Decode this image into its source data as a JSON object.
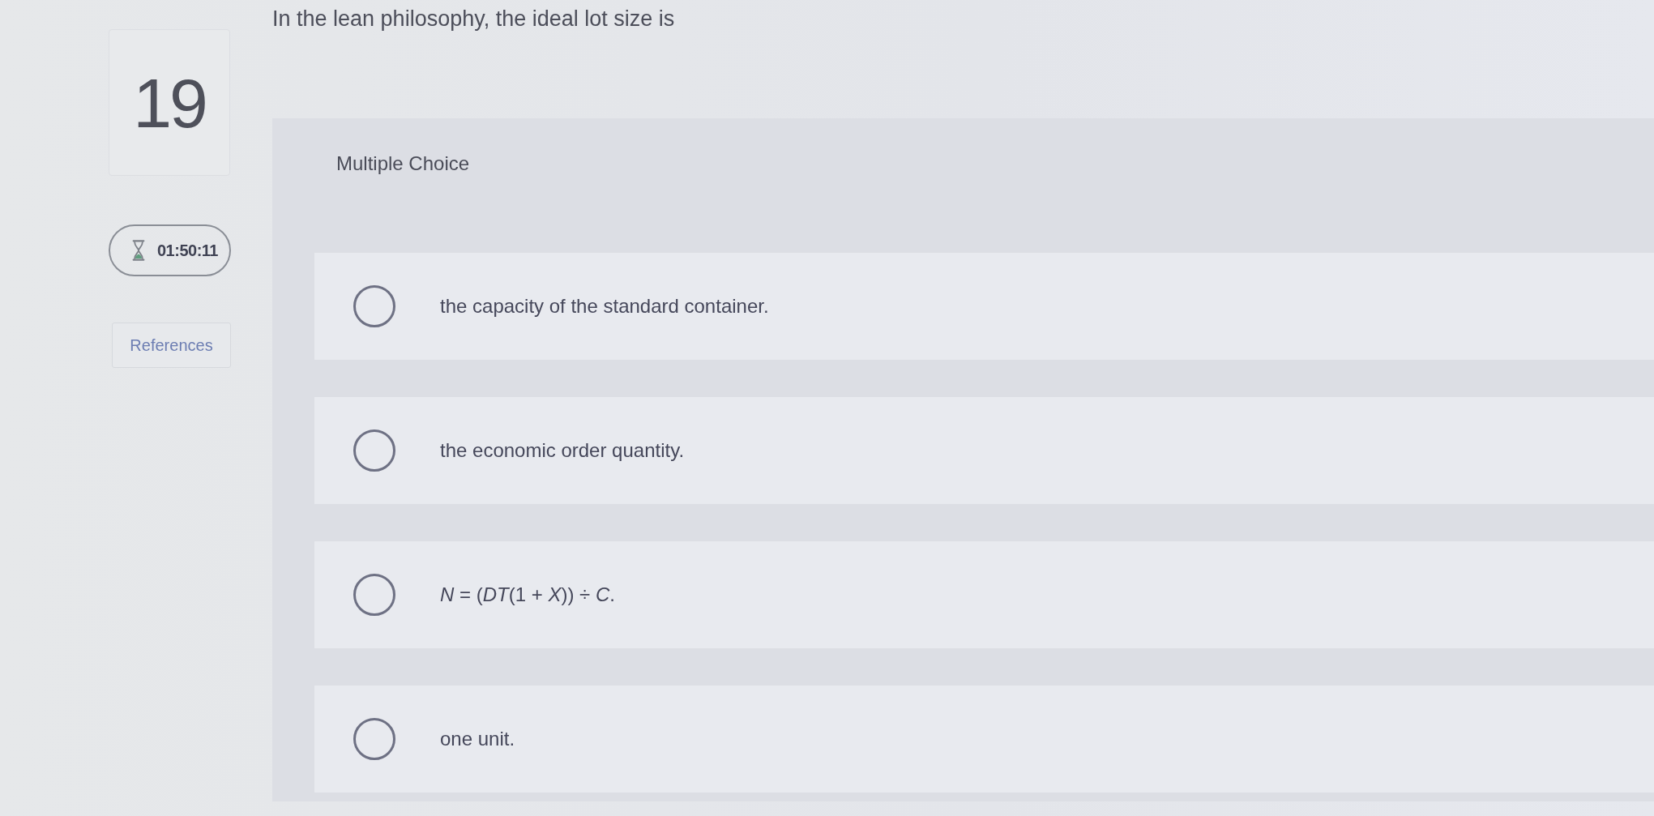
{
  "question": {
    "number": "19",
    "text": "In the lean philosophy, the ideal lot size is"
  },
  "timer": {
    "time": "01:50:11"
  },
  "references_button": {
    "label": "References"
  },
  "answer_panel": {
    "type_label": "Multiple Choice",
    "options": [
      {
        "text": "the capacity of the standard container.",
        "selected": false
      },
      {
        "text": "the economic order quantity.",
        "selected": false
      },
      {
        "text": "*N* = (*DT*(1 + *X*)) ÷ *C*.",
        "selected": false
      },
      {
        "text": "one unit.",
        "selected": false
      }
    ]
  }
}
